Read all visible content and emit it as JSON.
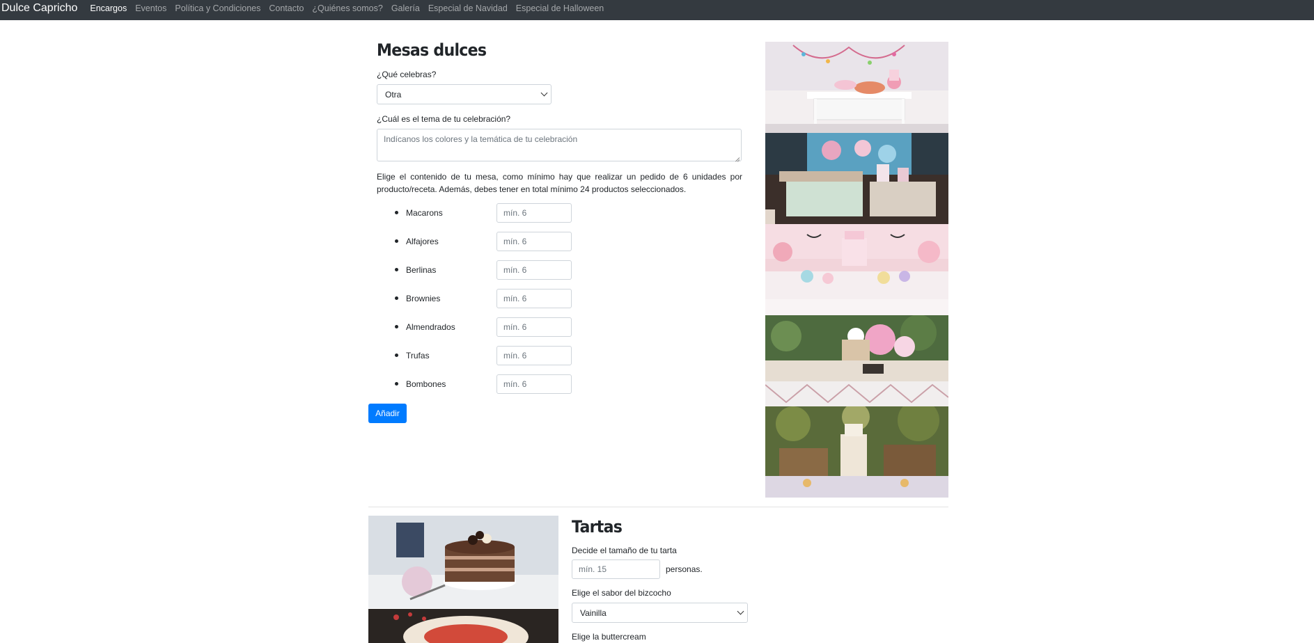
{
  "navbar": {
    "brand": "Dulce Capricho",
    "links": [
      {
        "label": "Encargos",
        "active": true
      },
      {
        "label": "Eventos"
      },
      {
        "label": "Política y Condiciones"
      },
      {
        "label": "Contacto"
      },
      {
        "label": "¿Quiénes somos?"
      },
      {
        "label": "Galería"
      },
      {
        "label": "Especial de Navidad"
      },
      {
        "label": "Especial de Halloween"
      }
    ]
  },
  "mesas": {
    "title": "Mesas dulces",
    "celebra_label": "¿Qué celebras?",
    "celebra_value": "Otra",
    "tema_label": "¿Cuál es el tema de tu celebración?",
    "tema_placeholder": "Indícanos los colores y la temática de tu celebración",
    "description": "Elige el contenido de tu mesa, como mínimo hay que realizar un pedido de 6 unidades por producto/receta. Además, debes tener en total mínimo 24 productos seleccionados.",
    "items": [
      {
        "name": "Macarons",
        "placeholder": "mín. 6"
      },
      {
        "name": "Alfajores",
        "placeholder": "mín. 6"
      },
      {
        "name": "Berlinas",
        "placeholder": "mín. 6"
      },
      {
        "name": "Brownies",
        "placeholder": "mín. 6"
      },
      {
        "name": "Almendrados",
        "placeholder": "mín. 6"
      },
      {
        "name": "Trufas",
        "placeholder": "mín. 6"
      },
      {
        "name": "Bombones",
        "placeholder": "mín. 6"
      }
    ],
    "add_button": "Añadir"
  },
  "tartas": {
    "title": "Tartas",
    "size_label": "Decide el tamaño de tu tarta",
    "size_placeholder": "mín. 15",
    "size_suffix": "personas.",
    "flavor_label": "Elige el sabor del bizcocho",
    "flavor_value": "Vainilla",
    "buttercream_label": "Elige la buttercream"
  },
  "colors": {
    "navbar_bg": "#343a40",
    "primary": "#007bff"
  }
}
